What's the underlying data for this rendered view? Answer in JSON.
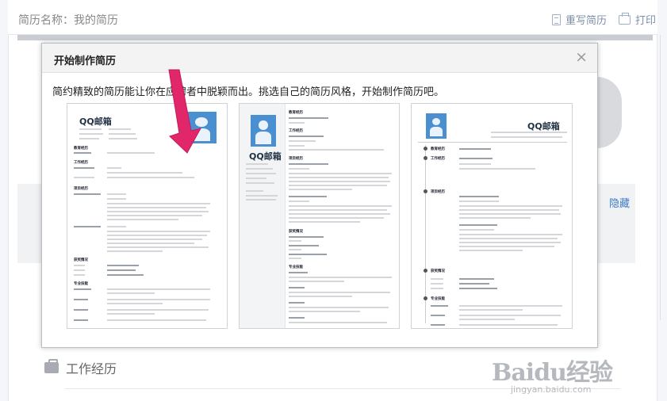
{
  "header": {
    "resume_name": "简历名称：我的简历",
    "rewrite_label": "重写简历",
    "print_label": "打印"
  },
  "background": {
    "hide_link": "隐藏",
    "work_section_title": "工作经历"
  },
  "modal": {
    "title": "开始制作简历",
    "close_symbol": "×",
    "description": "简约精致的简历能让你在应聘者中脱颖而出。挑选自己的简历风格，开始制作简历吧。"
  },
  "templates": [
    {
      "name": "QQ邮箱",
      "sections": [
        "教育经历",
        "工作经历",
        "项目经历",
        "获奖情况",
        "专业技能"
      ]
    },
    {
      "name": "QQ邮箱",
      "sections": [
        "教育经历",
        "工作经历",
        "项目经历",
        "获奖情况",
        "专业技能"
      ]
    },
    {
      "name": "QQ邮箱",
      "sections": [
        "教育经历",
        "工作经历",
        "项目经历",
        "获奖情况",
        "专业技能"
      ]
    }
  ],
  "watermark": {
    "logo": "Baidu经验",
    "url": "jingyan.baidu.com"
  },
  "colors": {
    "accent_link": "#3b79c8",
    "arrow": "#e2266a",
    "photo": "#4a8fd0"
  }
}
